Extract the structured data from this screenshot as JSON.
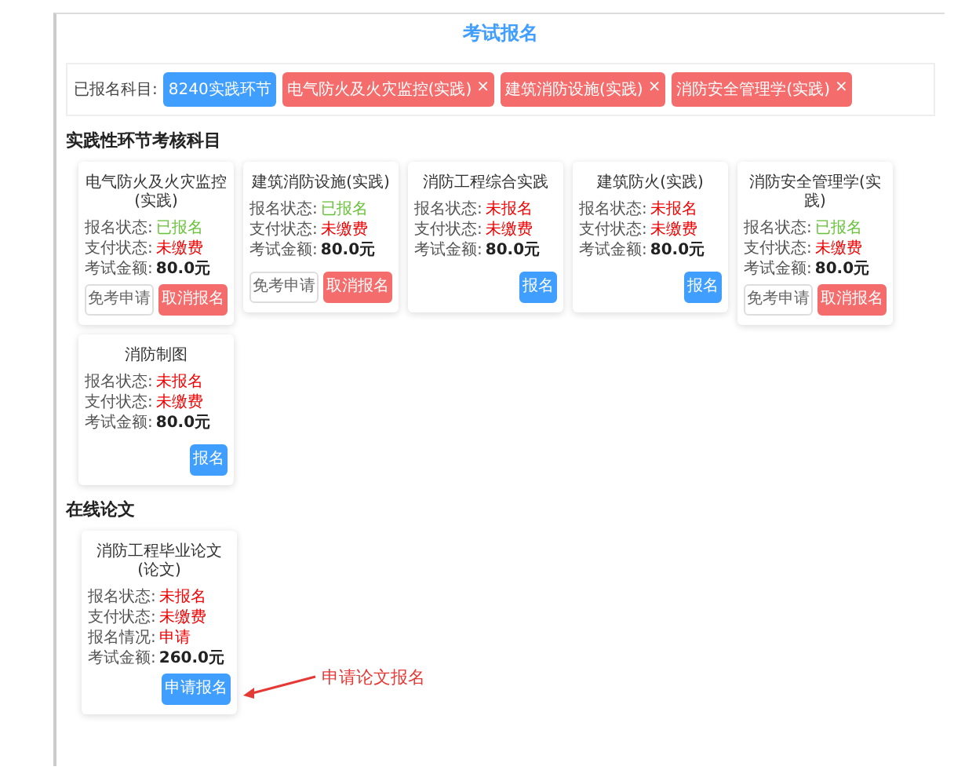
{
  "page": {
    "title": "考试报名"
  },
  "registered": {
    "label": "已报名科目:",
    "tags": [
      {
        "text": "8240实践环节",
        "kind": "info"
      },
      {
        "text": "电气防火及火灾监控(实践)",
        "kind": "removable",
        "close": "×"
      },
      {
        "text": "建筑消防设施(实践)",
        "kind": "removable",
        "close": "×"
      },
      {
        "text": "消防安全管理学(实践)",
        "kind": "removable",
        "close": "×"
      }
    ]
  },
  "sections": [
    {
      "heading": "实践性环节考核科目",
      "cards": [
        {
          "title": "电气防火及火灾监控(实践)",
          "rows": [
            {
              "label": "报名状态:",
              "value": "已报名",
              "kind": "status",
              "color": "#67c23a"
            },
            {
              "label": "支付状态:",
              "value": "未缴费",
              "kind": "status",
              "color": "#f00000"
            },
            {
              "label": "考试金额:",
              "value": "80.0元",
              "kind": "amount",
              "color": "#222222"
            }
          ],
          "buttons": [
            {
              "text": "免考申请",
              "kind": "plain"
            },
            {
              "text": "取消报名",
              "kind": "danger"
            }
          ]
        },
        {
          "title": "建筑消防设施(实践)",
          "rows": [
            {
              "label": "报名状态:",
              "value": "已报名",
              "kind": "status",
              "color": "#67c23a"
            },
            {
              "label": "支付状态:",
              "value": "未缴费",
              "kind": "status",
              "color": "#f00000"
            },
            {
              "label": "考试金额:",
              "value": "80.0元",
              "kind": "amount",
              "color": "#222222"
            }
          ],
          "buttons": [
            {
              "text": "免考申请",
              "kind": "plain"
            },
            {
              "text": "取消报名",
              "kind": "danger"
            }
          ]
        },
        {
          "title": "消防工程综合实践",
          "rows": [
            {
              "label": "报名状态:",
              "value": "未报名",
              "kind": "status",
              "color": "#f00000"
            },
            {
              "label": "支付状态:",
              "value": "未缴费",
              "kind": "status",
              "color": "#f00000"
            },
            {
              "label": "考试金额:",
              "value": "80.0元",
              "kind": "amount",
              "color": "#222222"
            }
          ],
          "buttons": [
            {
              "text": "报名",
              "kind": "primary"
            }
          ]
        },
        {
          "title": "建筑防火(实践)",
          "rows": [
            {
              "label": "报名状态:",
              "value": "未报名",
              "kind": "status",
              "color": "#f00000"
            },
            {
              "label": "支付状态:",
              "value": "未缴费",
              "kind": "status",
              "color": "#f00000"
            },
            {
              "label": "考试金额:",
              "value": "80.0元",
              "kind": "amount",
              "color": "#222222"
            }
          ],
          "buttons": [
            {
              "text": "报名",
              "kind": "primary"
            }
          ]
        },
        {
          "title": "消防安全管理学(实践)",
          "rows": [
            {
              "label": "报名状态:",
              "value": "已报名",
              "kind": "status",
              "color": "#67c23a"
            },
            {
              "label": "支付状态:",
              "value": "未缴费",
              "kind": "status",
              "color": "#f00000"
            },
            {
              "label": "考试金额:",
              "value": "80.0元",
              "kind": "amount",
              "color": "#222222"
            }
          ],
          "buttons": [
            {
              "text": "免考申请",
              "kind": "plain"
            },
            {
              "text": "取消报名",
              "kind": "danger"
            }
          ]
        },
        {
          "title": "消防制图",
          "rows": [
            {
              "label": "报名状态:",
              "value": "未报名",
              "kind": "status",
              "color": "#f00000"
            },
            {
              "label": "支付状态:",
              "value": "未缴费",
              "kind": "status",
              "color": "#f00000"
            },
            {
              "label": "考试金额:",
              "value": "80.0元",
              "kind": "amount",
              "color": "#222222"
            }
          ],
          "buttons": [
            {
              "text": "报名",
              "kind": "primary"
            }
          ]
        }
      ]
    },
    {
      "heading": "在线论文",
      "annotation": "申请论文报名",
      "cards": [
        {
          "title": "消防工程毕业论文(论文)",
          "rows": [
            {
              "label": "报名状态:",
              "value": "未报名",
              "kind": "status",
              "color": "#f00000"
            },
            {
              "label": "支付状态:",
              "value": "未缴费",
              "kind": "status",
              "color": "#f00000"
            },
            {
              "label": "报名情况:",
              "value": "申请",
              "kind": "status",
              "color": "#f00000"
            },
            {
              "label": "考试金额:",
              "value": "260.0元",
              "kind": "amount",
              "color": "#222222"
            }
          ],
          "buttons": [
            {
              "text": "申请报名",
              "kind": "primary"
            }
          ]
        }
      ]
    }
  ]
}
